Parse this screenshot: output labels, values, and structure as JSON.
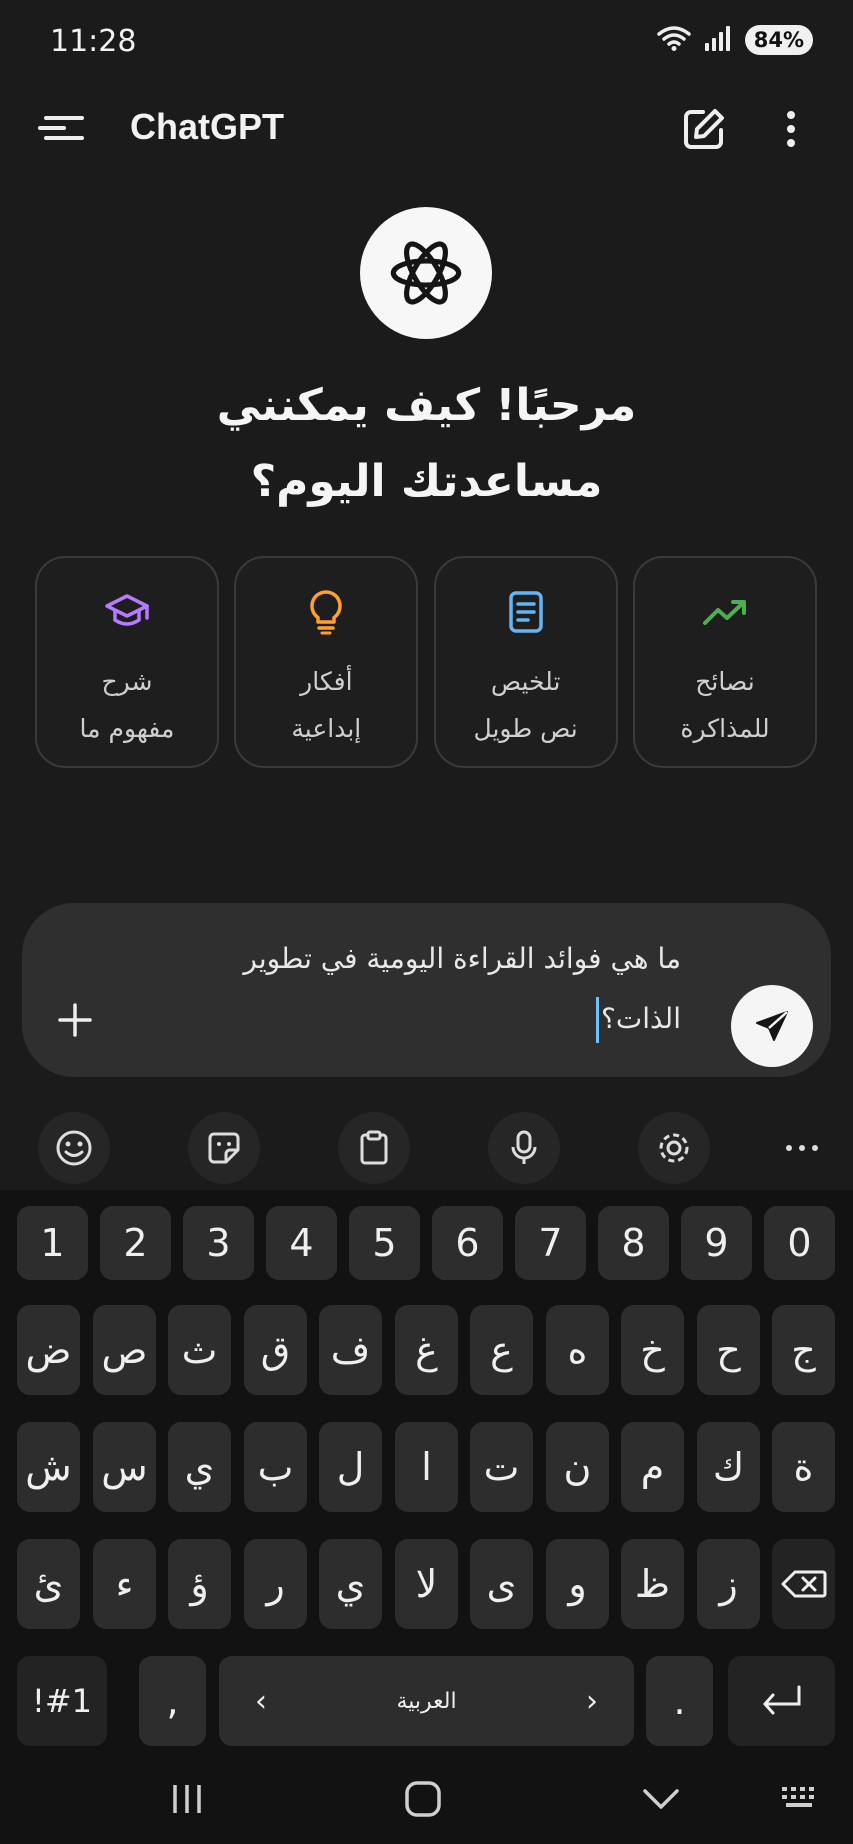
{
  "status_bar": {
    "time": "11:28",
    "battery": "84%"
  },
  "app_bar": {
    "title": "ChatGPT"
  },
  "greeting": {
    "line1": "مرحبًا! كيف يمكنني",
    "line2": "مساعدتك اليوم؟"
  },
  "cards": [
    {
      "line1": "نصائح",
      "line2": "للمذاكرة",
      "icon": "trend-up-icon",
      "color": "#4caf50"
    },
    {
      "line1": "تلخيص",
      "line2": "نص طويل",
      "icon": "document-icon",
      "color": "#64b5f6"
    },
    {
      "line1": "أفكار",
      "line2": "إبداعية",
      "icon": "lightbulb-icon",
      "color": "#ff9f2e"
    },
    {
      "line1": "شرح",
      "line2": "مفهوم ما",
      "icon": "graduation-cap-icon",
      "color": "#b57bff"
    }
  ],
  "composer": {
    "line1": "ما هي فوائد القراءة اليومية في تطوير",
    "line2": "الذات؟"
  },
  "keyboard": {
    "numbers": [
      "1",
      "2",
      "3",
      "4",
      "5",
      "6",
      "7",
      "8",
      "9",
      "0"
    ],
    "row1": [
      "ض",
      "ص",
      "ث",
      "ق",
      "ف",
      "غ",
      "ع",
      "ه",
      "خ",
      "ح",
      "ج"
    ],
    "row2": [
      "ش",
      "س",
      "ي",
      "ب",
      "ل",
      "ا",
      "ت",
      "ن",
      "م",
      "ك",
      "ة"
    ],
    "row3": [
      "ئ",
      "ء",
      "ؤ",
      "ر",
      "ي",
      "لا",
      "ى",
      "و",
      "ظ",
      "ز"
    ],
    "symbols": "!#1",
    "comma": ",",
    "language": "العربية",
    "period": "."
  },
  "colors": {
    "caret": "#6cc4ff"
  }
}
